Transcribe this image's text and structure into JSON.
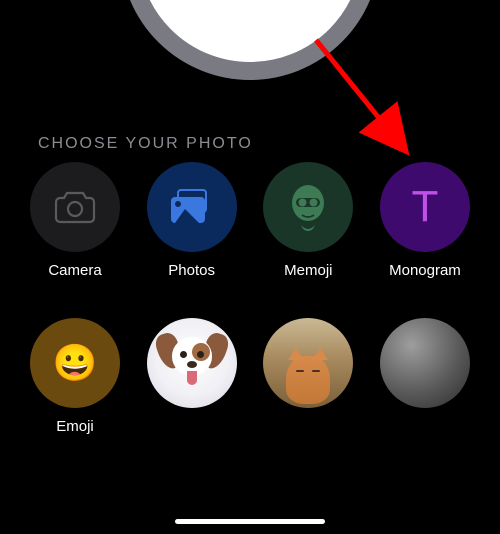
{
  "section_title": "CHOOSE YOUR PHOTO",
  "options": {
    "camera": {
      "label": "Camera"
    },
    "photos": {
      "label": "Photos"
    },
    "memoji": {
      "label": "Memoji"
    },
    "monogram": {
      "label": "Monogram",
      "letter": "T"
    },
    "emoji": {
      "label": "Emoji",
      "glyph": "😀"
    }
  }
}
